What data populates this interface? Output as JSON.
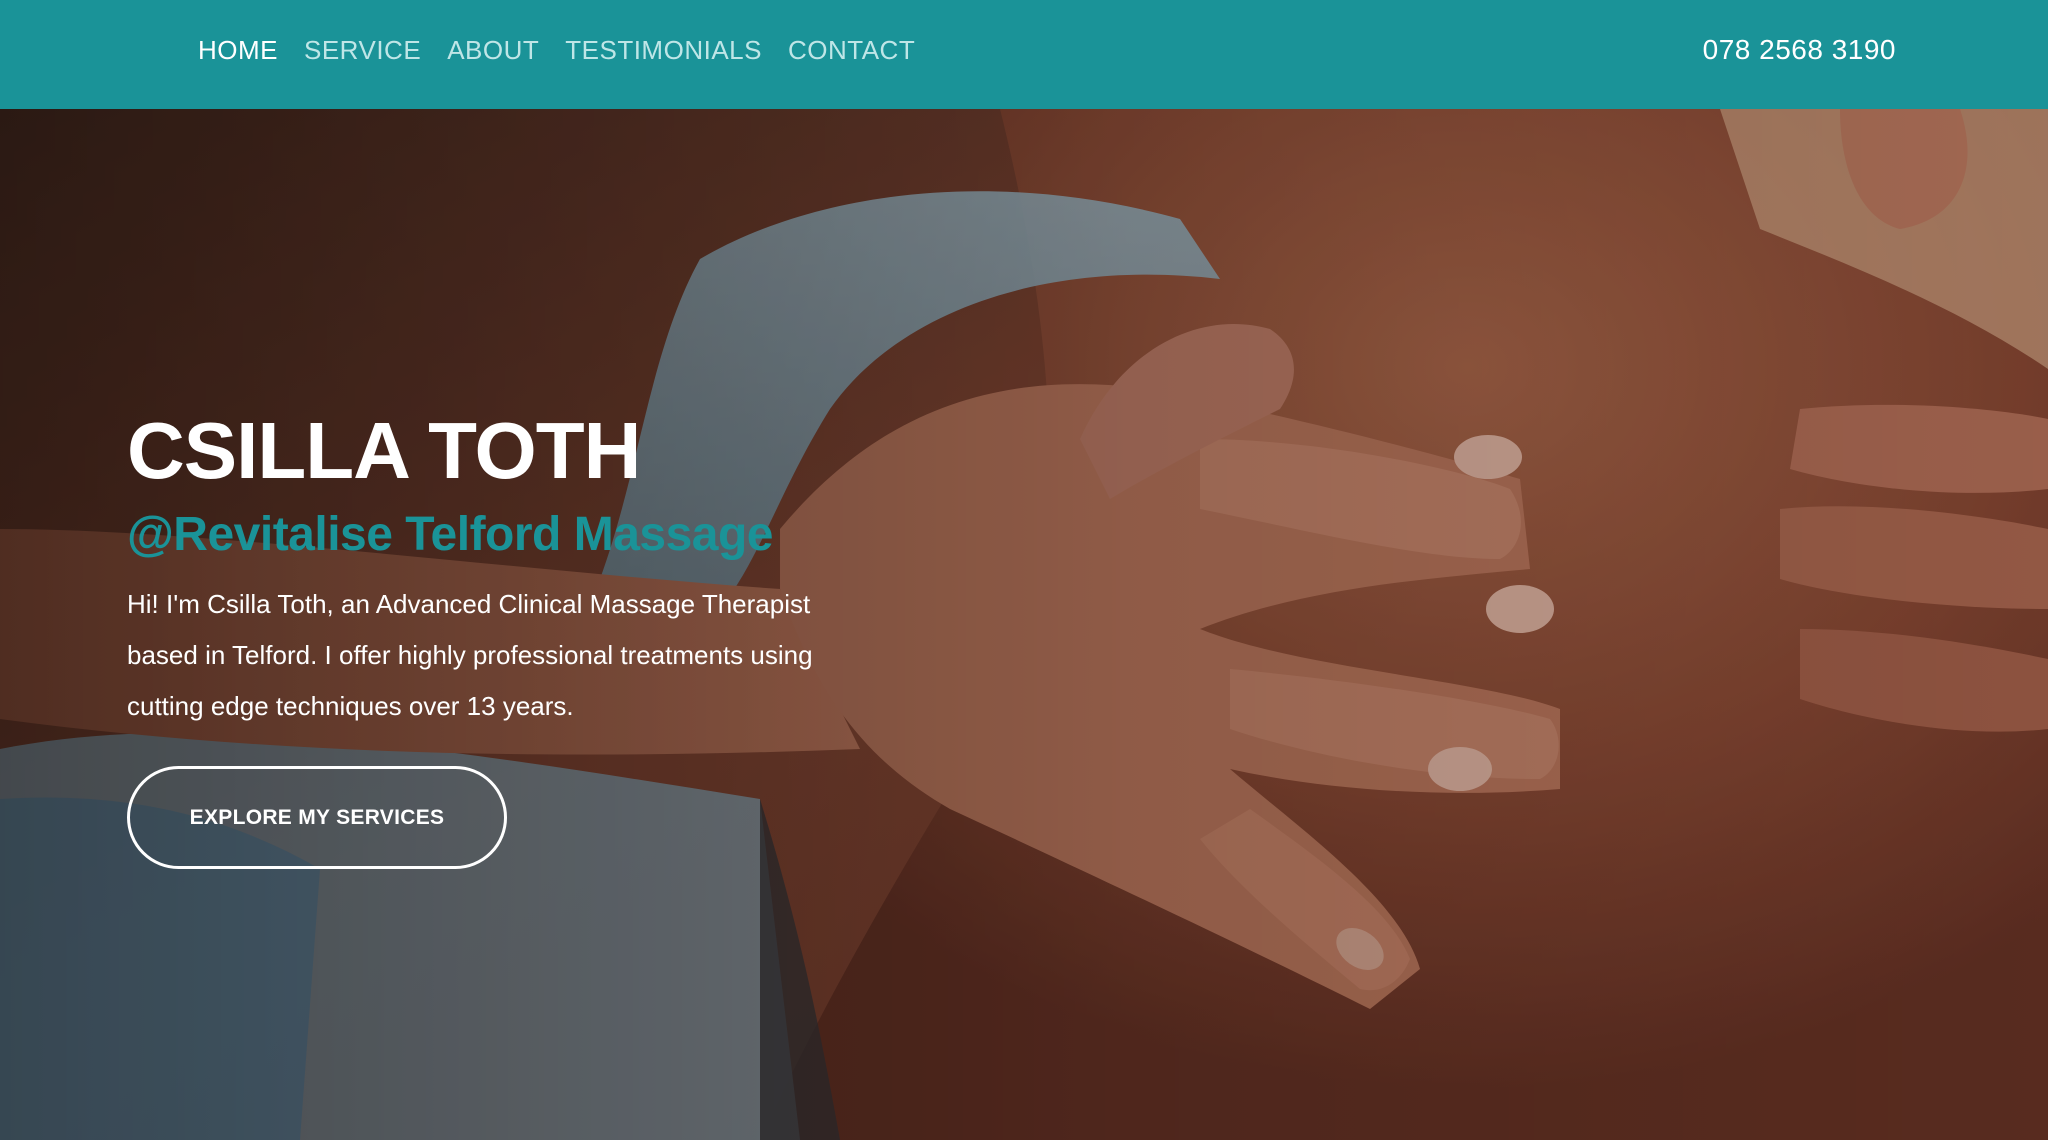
{
  "nav": {
    "links": [
      {
        "label": "HOME",
        "active": true
      },
      {
        "label": "SERVICE",
        "active": false
      },
      {
        "label": "ABOUT",
        "active": false
      },
      {
        "label": "TESTIMONIALS",
        "active": false
      },
      {
        "label": "CONTACT",
        "active": false
      }
    ],
    "phone": "078 2568 3190"
  },
  "hero": {
    "title": "CSILLA TOTH",
    "subtitle": "@Revitalise Telford Massage",
    "description": "Hi! I'm Csilla Toth, an Advanced Clinical Massage Therapist based in Telford. I offer highly professional treatments using cutting edge techniques over 13 years.",
    "cta_label": "EXPLORE MY SERVICES",
    "background_image": "massage-hands-on-back-photo"
  },
  "colors": {
    "brand_teal": "#1a9398",
    "nav_link_inactive": "#bfe6e7",
    "text_white": "#ffffff"
  }
}
